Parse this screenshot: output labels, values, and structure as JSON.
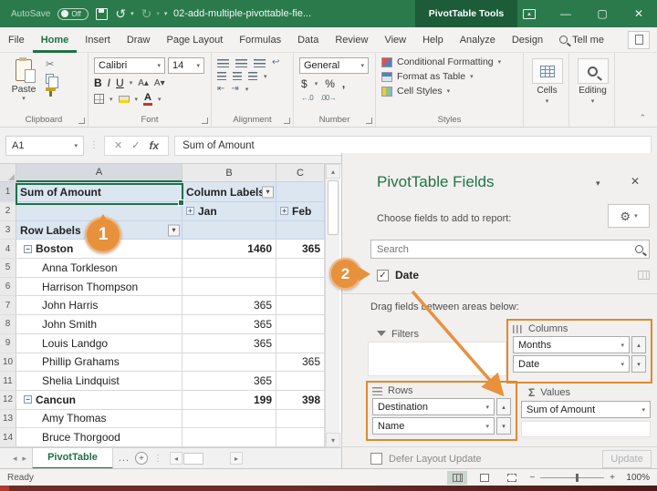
{
  "icons": {
    "caret_down": "▾",
    "caret_up": "▴",
    "close": "✕",
    "minimize": "—",
    "maximize": "▢",
    "check": "✓",
    "cancel": "✕",
    "scissors": "✂",
    "undo": "↺",
    "redo": "↻",
    "left": "◂",
    "right": "▸",
    "plus": "+",
    "minus": "−",
    "vdots": "⋮",
    "chevron_up": "⌃",
    "gear": "⚙",
    "sigma": "Σ",
    "increase_decimal": "←.0",
    "decrease_decimal": ".00→",
    "superscript_a": "A▴",
    "subscript_a": "A▾",
    "wrap": "↩",
    "indent_left": "⇤",
    "indent_right": "⇥"
  },
  "titlebar": {
    "autosave_label": "AutoSave",
    "autosave_state": "Off",
    "title": "02-add-multiple-pivottable-fie...",
    "contextual_tab": "PivotTable Tools"
  },
  "tabs": {
    "file": "File",
    "home": "Home",
    "insert": "Insert",
    "draw": "Draw",
    "page_layout": "Page Layout",
    "formulas": "Formulas",
    "data": "Data",
    "review": "Review",
    "view": "View",
    "help": "Help",
    "analyze": "Analyze",
    "design": "Design",
    "tell_me": "Tell me"
  },
  "ribbon": {
    "paste_label": "Paste",
    "font_name": "Calibri",
    "font_size": "14",
    "bold": "B",
    "italic": "I",
    "underline": "U",
    "number_format": "General",
    "currency": "$",
    "percent": "%",
    "comma": ",",
    "conditional_formatting": "Conditional Formatting",
    "format_as_table": "Format as Table",
    "cell_styles": "Cell Styles",
    "cells_label": "Cells",
    "editing_label": "Editing",
    "group_labels": {
      "clipboard": "Clipboard",
      "font": "Font",
      "alignment": "Alignment",
      "number": "Number",
      "styles": "Styles"
    }
  },
  "formula_bar": {
    "name_box": "A1",
    "fx": "fx",
    "value": "Sum of Amount"
  },
  "grid": {
    "col_headers": {
      "a": "A",
      "b": "B",
      "c": "C"
    },
    "rows": [
      {
        "num": "1",
        "a": "Sum of Amount",
        "b": "Column Labels",
        "c": ""
      },
      {
        "num": "2",
        "a": "",
        "b": "Jan",
        "c": "Feb"
      },
      {
        "num": "3",
        "a": "Row Labels",
        "b": "",
        "c": ""
      },
      {
        "num": "4",
        "a": "Boston",
        "b": "1460",
        "c": "365"
      },
      {
        "num": "5",
        "a": "Anna Torkleson",
        "b": "",
        "c": ""
      },
      {
        "num": "6",
        "a": "Harrison Thompson",
        "b": "",
        "c": ""
      },
      {
        "num": "7",
        "a": "John Harris",
        "b": "365",
        "c": ""
      },
      {
        "num": "8",
        "a": "John Smith",
        "b": "365",
        "c": ""
      },
      {
        "num": "9",
        "a": "Louis Landgo",
        "b": "365",
        "c": ""
      },
      {
        "num": "10",
        "a": "Phillip Grahams",
        "b": "",
        "c": "365"
      },
      {
        "num": "11",
        "a": "Shelia Lindquist",
        "b": "365",
        "c": ""
      },
      {
        "num": "12",
        "a": "Cancun",
        "b": "199",
        "c": "398"
      },
      {
        "num": "13",
        "a": "Amy Thomas",
        "b": "",
        "c": ""
      },
      {
        "num": "14",
        "a": "Bruce Thorgood",
        "b": "",
        "c": ""
      }
    ]
  },
  "pane": {
    "title": "PivotTable Fields",
    "choose_label": "Choose fields to add to report:",
    "search_placeholder": "Search",
    "field_date": "Date",
    "drag_label": "Drag fields between areas below:",
    "areas": {
      "filters": "Filters",
      "columns": "Columns",
      "rows": "Rows",
      "values": "Values"
    },
    "columns_item1": "Months",
    "columns_item2": "Date",
    "rows_item1": "Destination",
    "rows_item2": "Name",
    "values_item1": "Sum of Amount",
    "defer_label": "Defer Layout Update",
    "update_button": "Update"
  },
  "sheet_bar": {
    "tab": "PivotTable",
    "more": "..."
  },
  "status_bar": {
    "ready": "Ready",
    "zoom": "100%"
  },
  "annotations": {
    "step1": "1",
    "step2": "2"
  },
  "colors": {
    "excel_green": "#217346",
    "contextual_green": "#1d5c38",
    "annotation_orange": "#e8913d",
    "pivot_header_blue": "#dce6f1"
  }
}
